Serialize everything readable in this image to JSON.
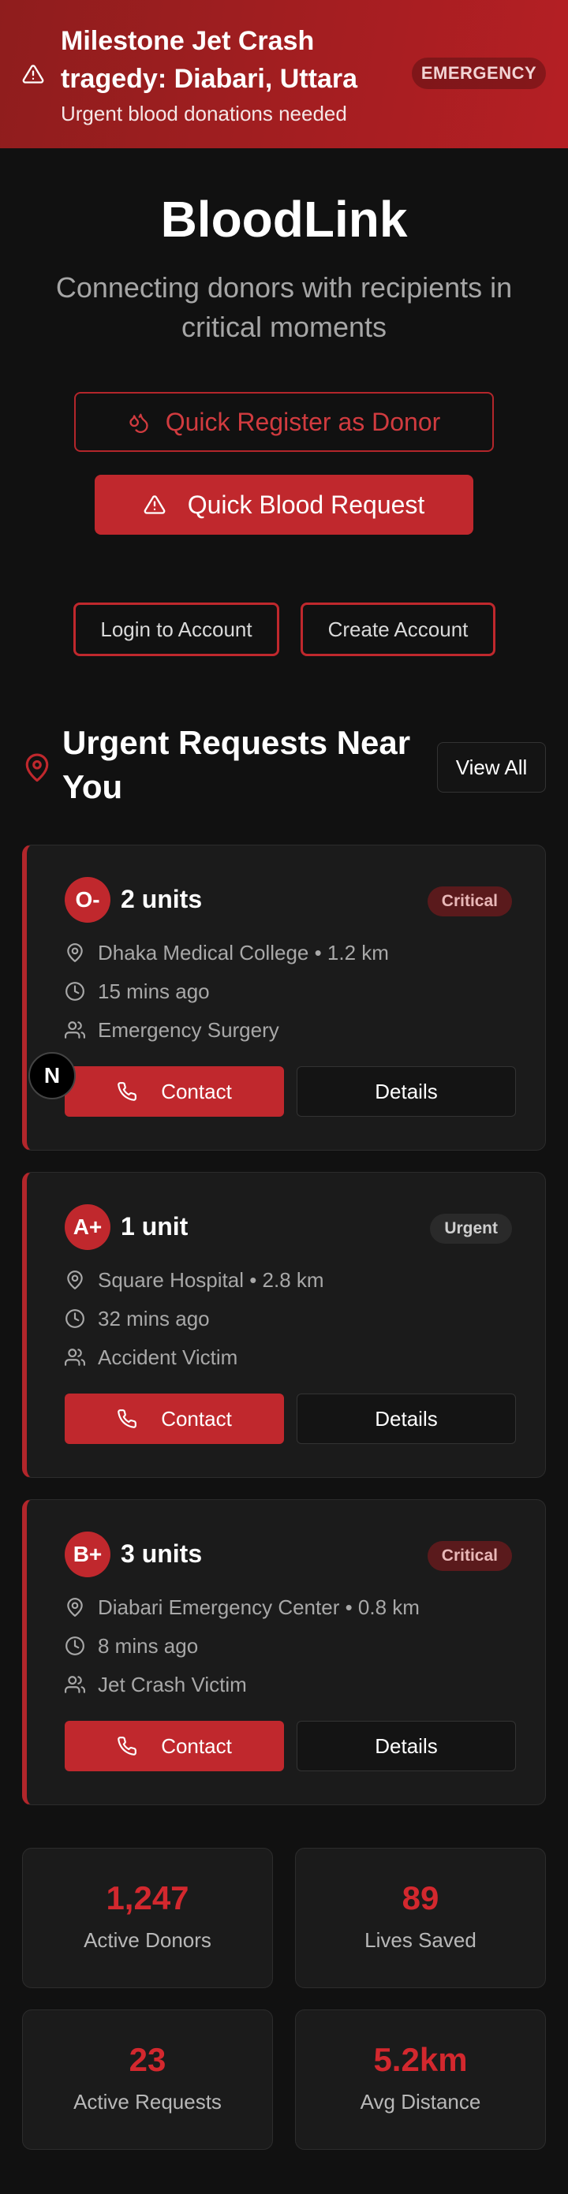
{
  "banner": {
    "title": "Milestone Jet Crash tragedy: Diabari, Uttara",
    "subtitle": "Urgent blood donations needed",
    "badge": "EMERGENCY"
  },
  "hero": {
    "title": "BloodLink",
    "subtitle": "Connecting donors with recipients in critical moments"
  },
  "actions": {
    "quick_register": "Quick Register as Donor",
    "quick_request": "Quick Blood Request",
    "login": "Login to Account",
    "create": "Create Account"
  },
  "section": {
    "title": "Urgent Requests Near You",
    "view_all": "View All"
  },
  "requests": [
    {
      "blood_type": "O-",
      "units": "2 units",
      "priority": "Critical",
      "location": "Dhaka Medical College • 1.2 km",
      "time": "15 mins ago",
      "reason": "Emergency Surgery",
      "contact": "Contact",
      "details": "Details"
    },
    {
      "blood_type": "A+",
      "units": "1 unit",
      "priority": "Urgent",
      "location": "Square Hospital • 2.8 km",
      "time": "32 mins ago",
      "reason": "Accident Victim",
      "contact": "Contact",
      "details": "Details"
    },
    {
      "blood_type": "B+",
      "units": "3 units",
      "priority": "Critical",
      "location": "Diabari Emergency Center • 0.8 km",
      "time": "8 mins ago",
      "reason": "Jet Crash Victim",
      "contact": "Contact",
      "details": "Details"
    }
  ],
  "stats": [
    {
      "value": "1,247",
      "label": "Active Donors"
    },
    {
      "value": "89",
      "label": "Lives Saved"
    },
    {
      "value": "23",
      "label": "Active Requests"
    },
    {
      "value": "5.2km",
      "label": "Avg Distance"
    }
  ],
  "floating_badge": "N",
  "colors": {
    "accent": "#c0282d",
    "background": "#111111",
    "card": "#1b1b1b"
  },
  "icons": {
    "banner": "warning-triangle-icon",
    "register": "droplet-icon",
    "request": "warning-triangle-icon",
    "section": "map-pin-icon",
    "location": "map-pin-icon",
    "time": "clock-icon",
    "patient": "users-icon",
    "contact": "phone-icon"
  }
}
